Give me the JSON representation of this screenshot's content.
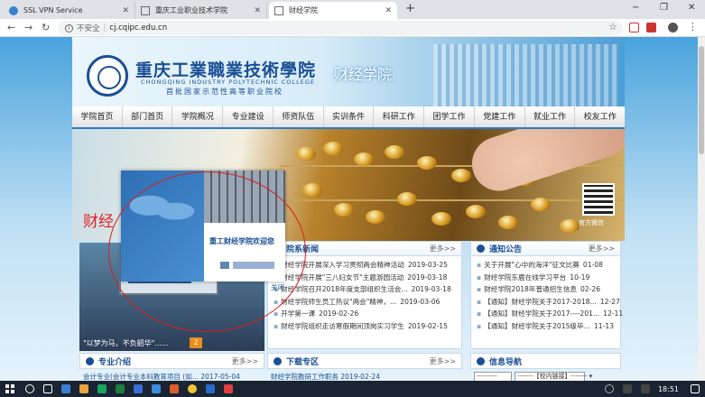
{
  "browser": {
    "tabs": [
      {
        "title": "SSL VPN Service",
        "icon_color": "#3b7fd0"
      },
      {
        "title": "重庆工业职业技术学院",
        "icon_color": "#6b6b6b"
      },
      {
        "title": "财经学院",
        "icon_color": "#6b6b6b",
        "active": true
      }
    ],
    "new_tab": "+",
    "window_controls": [
      "−",
      "❐",
      "✕"
    ],
    "nav": {
      "back": "←",
      "forward": "→",
      "reload": "↻"
    },
    "address": {
      "info_icon": "i",
      "security_label": "不安全",
      "separator": "|",
      "url": "cj.cqipc.edu.cn"
    },
    "star": "☆",
    "menu": "⋮"
  },
  "header": {
    "school_name_cn": "重庆工業職業技術學院",
    "school_name_en": "CHONGQING INDUSTRY POLYTECHNIC COLLEGE",
    "school_subtitle": "首批国家示范性高等职业院校",
    "college_title": "财经学院"
  },
  "nav": [
    "学院首页",
    "部门首页",
    "学院概况",
    "专业建设",
    "师资队伍",
    "实训条件",
    "科研工作",
    "团学工作",
    "党建工作",
    "就业工作",
    "校友工作"
  ],
  "banner": {
    "left_text": "财经",
    "qr_label": "官方微信"
  },
  "popup": {
    "welcome": "重工财经学院欢迎您"
  },
  "photo": {
    "caption": "\"以梦为马，不负韶华\"......",
    "badge": "2"
  },
  "college_news": {
    "title": "院系新闻",
    "more": "更多>>",
    "items": [
      {
        "text": "财经学院开展深入学习贯彻两会精神活动",
        "date": "2019-03-25"
      },
      {
        "text": "财经学院开展\"三八妇女节\"主题游园活动",
        "date": "2019-03-18"
      },
      {
        "text": "财经学院召开2018年度支部组织生活会...",
        "date": "2019-03-18"
      },
      {
        "text": "财经学院师生员工热议\"两会\"精神，...",
        "date": "2019-03-06"
      },
      {
        "text": "开学第一课",
        "date": "2019-02-26"
      },
      {
        "text": "财经学院组织走访寒假期间顶岗实习学生",
        "date": "2019-02-15"
      }
    ]
  },
  "notices": {
    "title": "通知公告",
    "more": "更多>>",
    "items": [
      {
        "text": "关于开展\"心中的海洋\"征文比赛",
        "date": "01-08"
      },
      {
        "text": "财经学院东鹿在线学习平台",
        "date": "10-19"
      },
      {
        "text": "财经学院2018年普通招生信息",
        "date": "02-26"
      },
      {
        "text": "【通知】财经学院关于2017-2018...",
        "date": "12-27"
      },
      {
        "text": "【通知】财经学院关于2017----201...",
        "date": "12-11"
      },
      {
        "text": "【通知】财经学院关于2015级毕...",
        "date": "11-13"
      }
    ]
  },
  "popup_side_text": "关闭",
  "sections": {
    "major": {
      "title": "专业介绍",
      "more": "更多>>",
      "first_row": "会计专业(会计专业本科教育项目 (如... 2017-05-04"
    },
    "download": {
      "title": "下载专区",
      "more": "更多>>",
      "first_row": "财经学院教研工作职务 2019-02-24"
    },
    "links": {
      "title": "信息导航",
      "select1": "---------",
      "select2": "-------【校内链接】------- ▾"
    }
  },
  "taskbar": {
    "time": "18:51",
    "icons": [
      "#ffffff",
      "#ffffff",
      "#3b7fd0",
      "#2b6ac9",
      "#e8a33d",
      "#19a463",
      "#1e7d3f",
      "#3a6fd8",
      "#3c8dde",
      "#dd5e2a",
      "#f0c537",
      "#2b6ac9",
      "#e04040"
    ]
  }
}
